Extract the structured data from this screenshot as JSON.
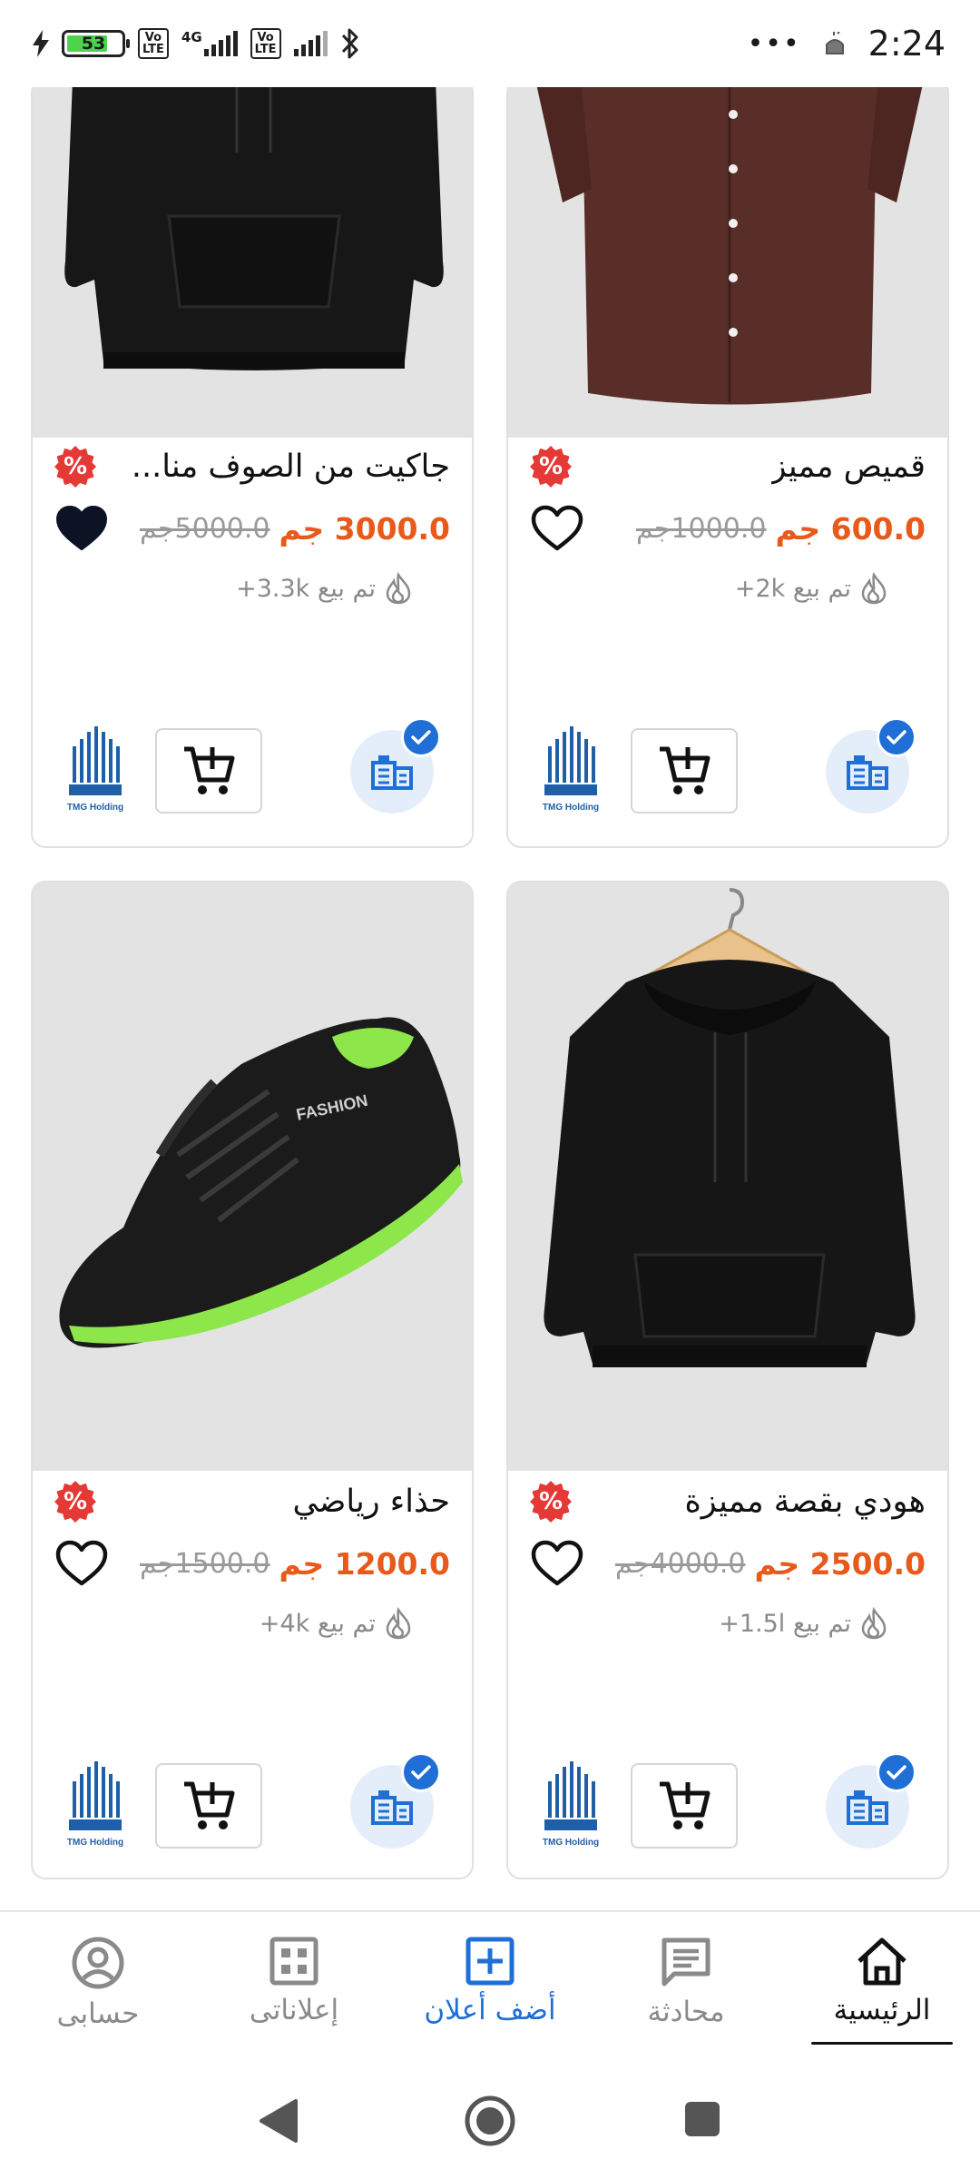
{
  "status_bar": {
    "battery": "53",
    "network": "4G",
    "volte": "Vo LTE",
    "dots": "•••",
    "time": "2:24"
  },
  "products": [
    {
      "title": "قميص مميز",
      "badge": "%",
      "price_new": "600.0 جم",
      "price_old": "1000.0جم",
      "sold": "تم بيع 2k+",
      "liked": false,
      "image": "brown-shirt"
    },
    {
      "title": "جاكيت من الصوف منا...",
      "badge": "%",
      "price_new": "3000.0 جم",
      "price_old": "5000.0جم",
      "sold": "تم بيع 3.3k+",
      "liked": true,
      "image": "black-jacket"
    },
    {
      "title": "هودي بقصة مميزة",
      "badge": "%",
      "price_new": "2500.0 جم",
      "price_old": "4000.0جم",
      "sold": "تم بيع 1.5l+",
      "liked": false,
      "image": "black-hoodie"
    },
    {
      "title": "حذاء رياضي",
      "badge": "%",
      "price_new": "1200.0 جم",
      "price_old": "1500.0جم",
      "sold": "تم بيع 4k+",
      "liked": false,
      "image": "sneaker"
    }
  ],
  "seller_logo_text": "TMG Holding",
  "shoe_brand_text": "FASHION",
  "bottom_nav": {
    "account": "حسابى",
    "my_ads": "إعلاناتى",
    "add_ad": "أضف أعلان",
    "chat": "محادثة",
    "home": "الرئيسية"
  },
  "colors": {
    "accent": "#1f6fd6",
    "price": "#e8591a",
    "badge": "#e53935"
  }
}
